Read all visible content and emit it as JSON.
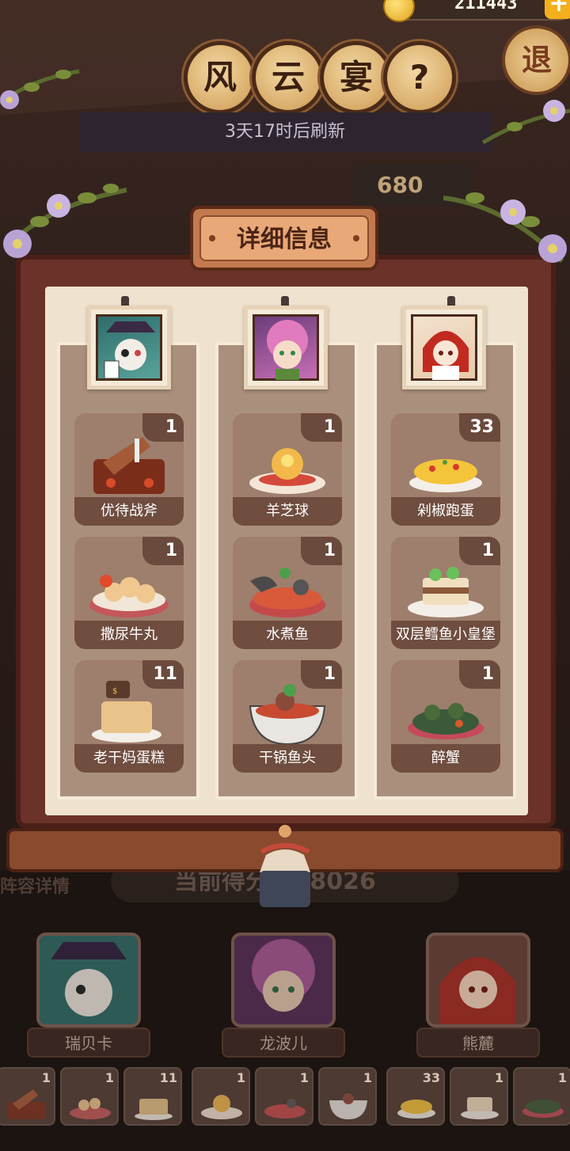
{
  "currency": {
    "value": "211443",
    "icon": "coin-icon",
    "add_icon": "plus-icon"
  },
  "header": {
    "title_chars": [
      "风",
      "云",
      "宴"
    ],
    "help_label": "?",
    "exit_label": "退",
    "refresh_text": "3天17时后刷新",
    "score_chip": "680"
  },
  "panel": {
    "title": "详细信息",
    "columns": [
      {
        "chef_icon": "chef-portrait-rebecca",
        "dishes": [
          {
            "name": "优待战斧",
            "count": "1"
          },
          {
            "name": "撒尿牛丸",
            "count": "1"
          },
          {
            "name": "老干妈蛋糕",
            "count": "11"
          }
        ]
      },
      {
        "chef_icon": "chef-portrait-longboer",
        "dishes": [
          {
            "name": "羊芝球",
            "count": "1"
          },
          {
            "name": "水煮鱼",
            "count": "1"
          },
          {
            "name": "干锅鱼头",
            "count": "1"
          }
        ]
      },
      {
        "chef_icon": "chef-portrait-xionglu",
        "dishes": [
          {
            "name": "剁椒跑蛋",
            "count": "33"
          },
          {
            "name": "双层鳕鱼小皇堡",
            "count": "1"
          },
          {
            "name": "醉蟹",
            "count": "1"
          }
        ]
      }
    ]
  },
  "bottom": {
    "team_detail": "阵容详情",
    "score_label": "当前得分",
    "score_value": "68026",
    "chefs": [
      {
        "name": "瑞贝卡"
      },
      {
        "name": "龙波儿"
      },
      {
        "name": "熊麓"
      }
    ],
    "slots": [
      "1",
      "1",
      "11",
      "1",
      "1",
      "1",
      "33",
      "1",
      "1"
    ]
  },
  "colors": {
    "panel_frame": "#6a3228",
    "panel_inner": "#efe2cf",
    "card_bg": "#9e7e6c",
    "card_label_bg": "#6f4d3f",
    "title_plate": "#e9a877",
    "gold": "#f3b01c"
  }
}
